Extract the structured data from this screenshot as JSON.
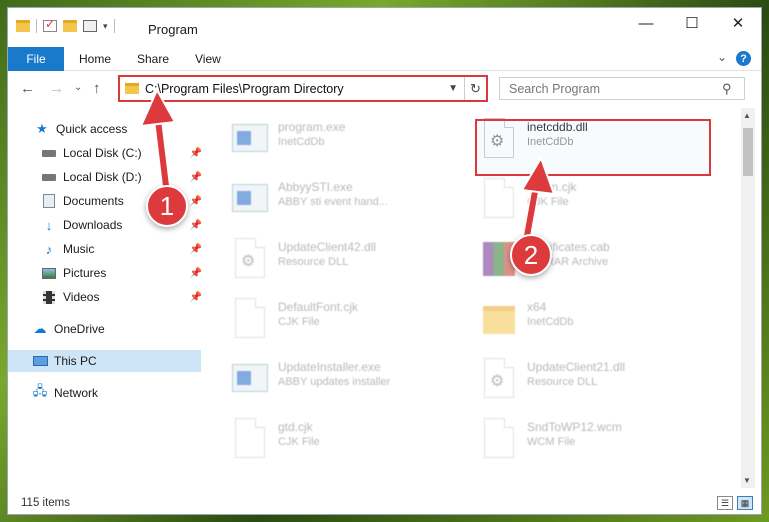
{
  "window": {
    "title": "Program",
    "controls": {
      "minimize": "—",
      "maximize": "☐",
      "close": "✕"
    }
  },
  "ribbon": {
    "tabs": [
      "File",
      "Home",
      "Share",
      "View"
    ],
    "help": "?"
  },
  "nav": {
    "back": "←",
    "forward": "→",
    "recent": "⌄",
    "up": "↑",
    "address": "C:\\Program Files\\Program Directory",
    "search_placeholder": "Search Program"
  },
  "sidebar": {
    "quick_access": "Quick access",
    "items": [
      {
        "label": "Local Disk (C:)",
        "icon": "drive-icon",
        "pinned": true
      },
      {
        "label": "Local Disk (D:)",
        "icon": "drive-icon",
        "pinned": true
      },
      {
        "label": "Documents",
        "icon": "documents-icon",
        "pinned": true
      },
      {
        "label": "Downloads",
        "icon": "downloads-icon",
        "pinned": true
      },
      {
        "label": "Music",
        "icon": "music-icon",
        "pinned": true
      },
      {
        "label": "Pictures",
        "icon": "pictures-icon",
        "pinned": true
      },
      {
        "label": "Videos",
        "icon": "videos-icon",
        "pinned": true
      }
    ],
    "onedrive": "OneDrive",
    "this_pc": "This PC",
    "network": "Network"
  },
  "files": [
    {
      "name": "program.exe",
      "sub": "InetCdDb",
      "type": "exe"
    },
    {
      "name": "inetcddb.dll",
      "sub": "InetCdDb",
      "type": "dll"
    },
    {
      "name": "AbbyySTI.exe",
      "sub": "ABBY sti event hand...",
      "type": "exe"
    },
    {
      "name": "Clean.cjk",
      "sub": "CJK File",
      "type": "doc"
    },
    {
      "name": "UpdateClient42.dll",
      "sub": "Resource DLL",
      "type": "dll"
    },
    {
      "name": "Certificates.cab",
      "sub": "WinRAR Archive",
      "type": "archive"
    },
    {
      "name": "DefaultFont.cjk",
      "sub": "CJK File",
      "type": "doc"
    },
    {
      "name": "x64",
      "sub": "InetCdDb",
      "type": "folder"
    },
    {
      "name": "UpdateInstaller.exe",
      "sub": "ABBY updates installer",
      "type": "exe"
    },
    {
      "name": "UpdateClient21.dll",
      "sub": "Resource DLL",
      "type": "dll"
    },
    {
      "name": "gtd.cjk",
      "sub": "CJK File",
      "type": "doc"
    },
    {
      "name": "SndToWP12.wcm",
      "sub": "WCM File",
      "type": "doc"
    }
  ],
  "status": {
    "count": "115 items"
  },
  "annotations": {
    "badge1": "1",
    "badge2": "2"
  },
  "colors": {
    "accent": "#1979ca",
    "highlight": "#d9393c",
    "selection": "#cde5f7"
  }
}
